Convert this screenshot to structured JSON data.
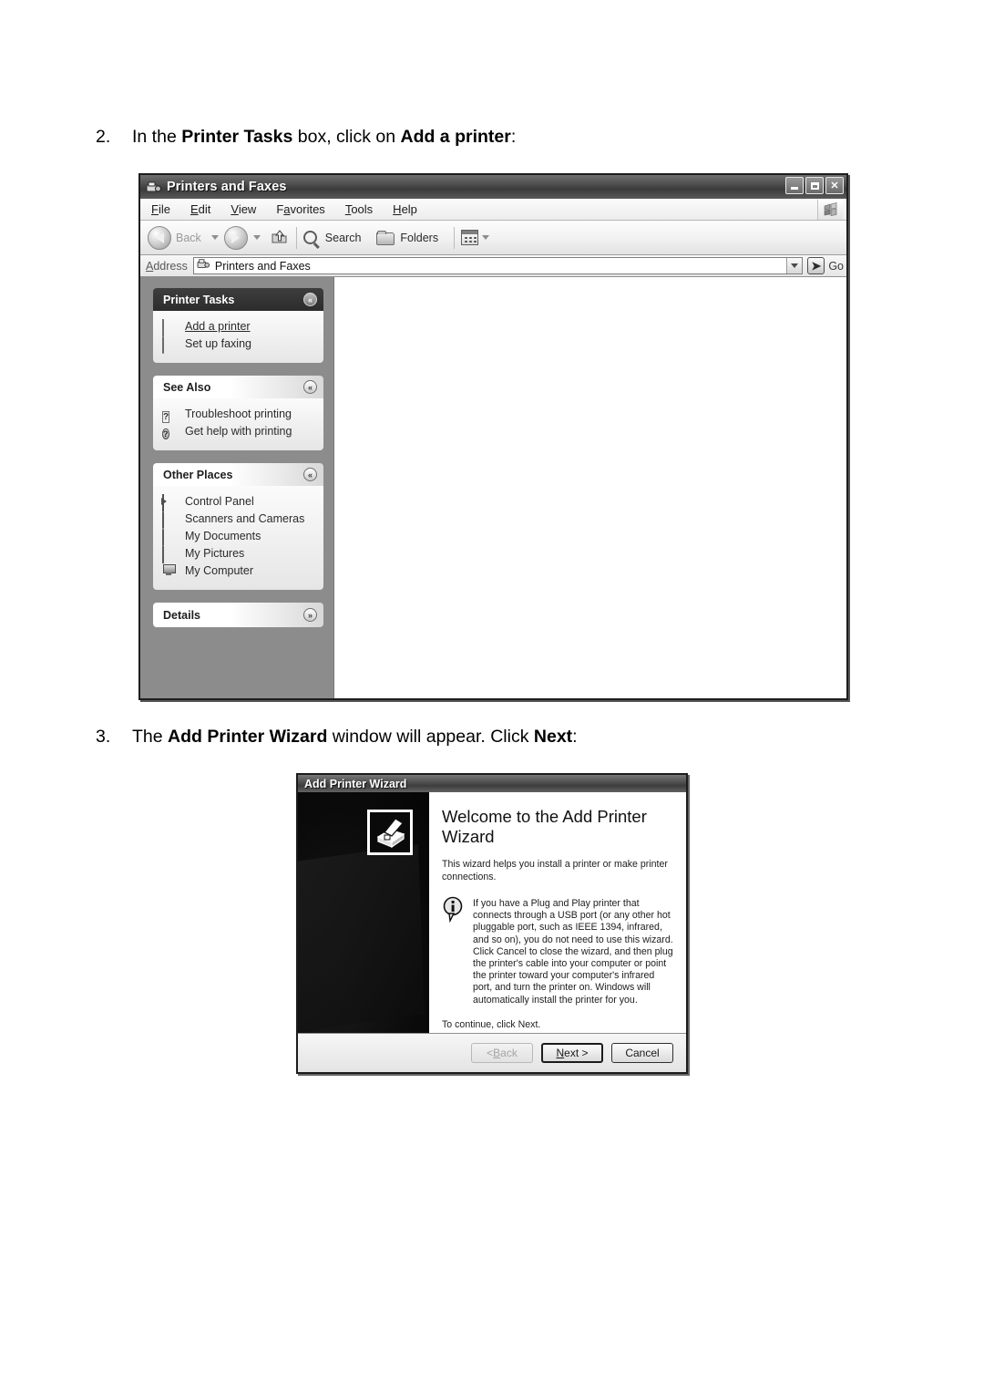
{
  "document": {
    "steps": [
      {
        "number": "2.",
        "parts": [
          {
            "text": "In the ",
            "bold": false
          },
          {
            "text": "Printer Tasks",
            "bold": true
          },
          {
            "text": " box, click on ",
            "bold": false
          },
          {
            "text": "Add a printer",
            "bold": true
          },
          {
            "text": ":",
            "bold": false
          }
        ]
      },
      {
        "number": "3.",
        "parts": [
          {
            "text": "The ",
            "bold": false
          },
          {
            "text": "Add Printer Wizard",
            "bold": true
          },
          {
            "text": " window will appear. Click ",
            "bold": false
          },
          {
            "text": "Next",
            "bold": true
          },
          {
            "text": ":",
            "bold": false
          }
        ]
      }
    ]
  },
  "explorer": {
    "title": "Printers and Faxes",
    "title_icon": "printer-fax-icon",
    "window_buttons": [
      {
        "name": "minimize-button",
        "glyph": "_"
      },
      {
        "name": "maximize-button",
        "glyph": "□"
      },
      {
        "name": "close-button",
        "glyph": "✕"
      }
    ],
    "menu": [
      {
        "label": "File",
        "accel": "F"
      },
      {
        "label": "Edit",
        "accel": "E"
      },
      {
        "label": "View",
        "accel": "V"
      },
      {
        "label": "Favorites",
        "accel": "a"
      },
      {
        "label": "Tools",
        "accel": "T"
      },
      {
        "label": "Help",
        "accel": "H"
      }
    ],
    "toolbar": {
      "back_label": "Back",
      "search_label": "Search",
      "folders_label": "Folders",
      "views_label": "Views"
    },
    "address": {
      "label": "Address",
      "value": "Printers and Faxes",
      "go_label": "Go"
    },
    "panels": [
      {
        "name": "printer-tasks",
        "title": "Printer Tasks",
        "style": "dark",
        "chevron": "«",
        "items": [
          {
            "label": "Add a printer",
            "icon": "add-printer-icon",
            "link": true
          },
          {
            "label": "Set up faxing",
            "icon": "fax-icon",
            "link": false
          }
        ]
      },
      {
        "name": "see-also",
        "title": "See Also",
        "style": "light",
        "chevron": "«",
        "items": [
          {
            "label": "Troubleshoot printing",
            "icon": "question-icon",
            "link": false
          },
          {
            "label": "Get help with printing",
            "icon": "help-icon",
            "link": false
          }
        ]
      },
      {
        "name": "other-places",
        "title": "Other Places",
        "style": "light",
        "chevron": "«",
        "items": [
          {
            "label": "Control Panel",
            "icon": "control-panel-icon",
            "link": false
          },
          {
            "label": "Scanners and Cameras",
            "icon": "scanner-icon",
            "link": false
          },
          {
            "label": "My Documents",
            "icon": "documents-icon",
            "link": false
          },
          {
            "label": "My Pictures",
            "icon": "pictures-icon",
            "link": false
          },
          {
            "label": "My Computer",
            "icon": "computer-icon",
            "link": false
          }
        ]
      },
      {
        "name": "details",
        "title": "Details",
        "style": "light",
        "chevron": "»",
        "items": []
      }
    ]
  },
  "wizard": {
    "title": "Add Printer Wizard",
    "printer_icon": "printer-icon",
    "heading": "Welcome to the Add Printer Wizard",
    "intro": "This wizard helps you install a printer or make printer connections.",
    "note_icon": "info-icon",
    "note": "If you have a Plug and Play printer that connects through a USB port (or any other hot pluggable port, such as IEEE 1394, infrared, and so on), you do not need to use this wizard. Click Cancel to close the wizard, and then plug the printer's cable into your computer or point the printer toward your computer's infrared port, and turn the printer on. Windows will automatically install the printer for you.",
    "continue": "To continue, click Next.",
    "buttons": {
      "back": "< Back",
      "next": "Next >",
      "cancel": "Cancel"
    }
  }
}
